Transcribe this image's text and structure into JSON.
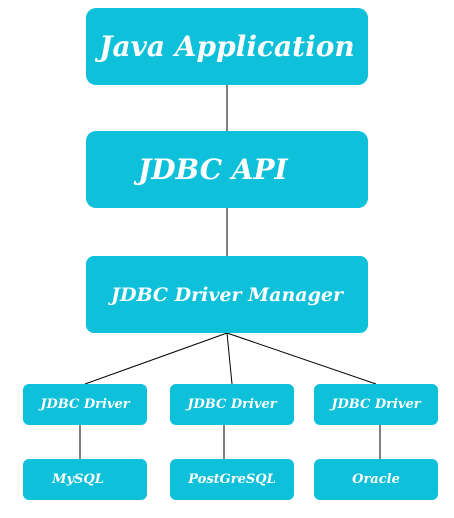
{
  "diagram": {
    "colors": {
      "box_fill": "#0ec0d9",
      "box_text": "#ffffff",
      "connector": "#000000"
    },
    "nodes": {
      "java_application": "Java Application",
      "jdbc_api": "JDBC API",
      "driver_manager": "JDBC Driver Manager",
      "drivers": [
        "JDBC Driver",
        "JDBC Driver",
        "JDBC Driver"
      ],
      "databases": [
        "MySQL",
        "PostGreSQL",
        "Oracle"
      ]
    }
  }
}
